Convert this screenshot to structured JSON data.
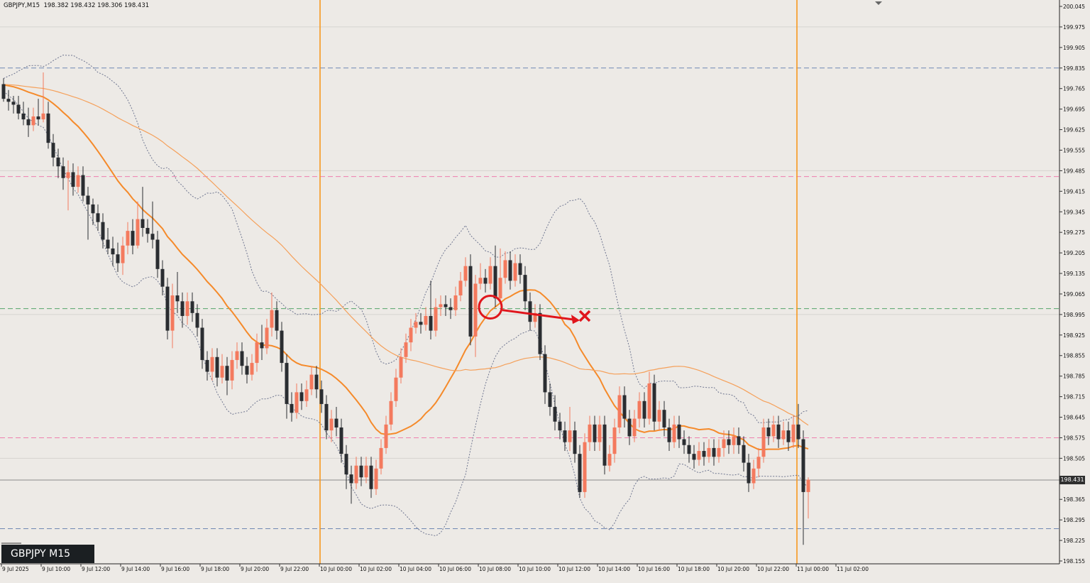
{
  "header": {
    "symbol": "GBPJPY,M15",
    "ohlc": "198.382 198.432 198.306 198.431"
  },
  "chart_tag": "GBPJPY M15",
  "current_price_label": "198.431",
  "colors": {
    "background": "#edeae6",
    "bull_candle": "#f47a5e",
    "bear_candle": "#2a2d31",
    "ma_fast": "#f58a2a",
    "ma_slow": "#f5a05a",
    "bollinger": "#6f7690",
    "session_line": "#f7971e",
    "annotation": "#e0151c"
  },
  "chart_data": {
    "type": "candlestick",
    "timeframe": "M15",
    "ylim": [
      198.155,
      200.045
    ],
    "y_ticks": [
      "200.045",
      "199.975",
      "199.905",
      "199.835",
      "199.765",
      "199.695",
      "199.625",
      "199.555",
      "199.485",
      "199.415",
      "199.345",
      "199.275",
      "199.205",
      "199.135",
      "199.065",
      "198.995",
      "198.925",
      "198.855",
      "198.785",
      "198.715",
      "198.645",
      "198.575",
      "198.505",
      "198.435",
      "198.365",
      "198.295",
      "198.225",
      "198.155"
    ],
    "x_ticks": [
      "9 Jul 2025",
      "9 Jul 10:00",
      "9 Jul 12:00",
      "9 Jul 14:00",
      "9 Jul 16:00",
      "9 Jul 18:00",
      "9 Jul 20:00",
      "9 Jul 22:00",
      "10 Jul 00:00",
      "10 Jul 02:00",
      "10 Jul 04:00",
      "10 Jul 06:00",
      "10 Jul 08:00",
      "10 Jul 10:00",
      "10 Jul 12:00",
      "10 Jul 14:00",
      "10 Jul 16:00",
      "10 Jul 18:00",
      "10 Jul 20:00",
      "10 Jul 22:00",
      "11 Jul 00:00",
      "11 Jul 02:00"
    ],
    "current_price": 198.431,
    "horizontal_levels": [
      {
        "price": 199.835,
        "style": "blue-dashed"
      },
      {
        "price": 199.465,
        "style": "pink-dashed"
      },
      {
        "price": 199.015,
        "style": "green-dashed"
      },
      {
        "price": 198.575,
        "style": "pink-dashed"
      },
      {
        "price": 198.265,
        "style": "blue-dashed"
      }
    ],
    "session_lines": [
      "10 Jul 00:00",
      "11 Jul 00:00"
    ],
    "series": [
      {
        "indicator": "moving-average-fast"
      },
      {
        "indicator": "moving-average-slow"
      },
      {
        "indicator": "bollinger-bands"
      }
    ],
    "annotations": [
      {
        "type": "circle",
        "price": 199.02
      },
      {
        "type": "arrow",
        "from_price": 199.01,
        "to_price": 198.975
      },
      {
        "type": "cross",
        "price": 198.99
      }
    ],
    "candles": [
      [
        199.78,
        199.73,
        199.8,
        199.72
      ],
      [
        199.73,
        199.72,
        199.76,
        199.69
      ],
      [
        199.72,
        199.71,
        199.74,
        199.68
      ],
      [
        199.71,
        199.68,
        199.74,
        199.66
      ],
      [
        199.68,
        199.66,
        199.72,
        199.64
      ],
      [
        199.66,
        199.64,
        199.7,
        199.6
      ],
      [
        199.64,
        199.67,
        199.7,
        199.62
      ],
      [
        199.67,
        199.66,
        199.73,
        199.64
      ],
      [
        199.66,
        199.68,
        199.82,
        199.65
      ],
      [
        199.68,
        199.58,
        199.72,
        199.56
      ],
      [
        199.58,
        199.53,
        199.61,
        199.5
      ],
      [
        199.53,
        199.5,
        199.56,
        199.46
      ],
      [
        199.5,
        199.46,
        199.53,
        199.42
      ],
      [
        199.46,
        199.48,
        199.52,
        199.35
      ],
      [
        199.48,
        199.43,
        199.51,
        199.4
      ],
      [
        199.43,
        199.47,
        199.5,
        199.41
      ],
      [
        199.47,
        199.4,
        199.5,
        199.38
      ],
      [
        199.4,
        199.37,
        199.43,
        199.25
      ],
      [
        199.37,
        199.34,
        199.39,
        199.3
      ],
      [
        199.34,
        199.31,
        199.37,
        199.28
      ],
      [
        199.31,
        199.25,
        199.34,
        199.22
      ],
      [
        199.25,
        199.22,
        199.29,
        199.2
      ],
      [
        199.22,
        199.2,
        199.26,
        199.16
      ],
      [
        199.2,
        199.17,
        199.24,
        199.14
      ],
      [
        199.17,
        199.23,
        199.26,
        199.13
      ],
      [
        199.23,
        199.28,
        199.31,
        199.2
      ],
      [
        199.28,
        199.23,
        199.32,
        199.2
      ],
      [
        199.23,
        199.32,
        199.38,
        199.22
      ],
      [
        199.32,
        199.29,
        199.43,
        199.26
      ],
      [
        199.29,
        199.27,
        199.32,
        199.24
      ],
      [
        199.27,
        199.25,
        199.38,
        199.22
      ],
      [
        199.25,
        199.15,
        199.28,
        199.12
      ],
      [
        199.15,
        199.09,
        199.18,
        199.06
      ],
      [
        199.09,
        198.94,
        199.12,
        198.91
      ],
      [
        198.94,
        199.06,
        199.1,
        198.88
      ],
      [
        199.06,
        199.04,
        199.14,
        199.0
      ],
      [
        199.04,
        198.99,
        199.07,
        198.95
      ],
      [
        198.99,
        199.04,
        199.07,
        198.96
      ],
      [
        199.04,
        199.0,
        199.07,
        198.97
      ],
      [
        199.0,
        198.95,
        199.03,
        198.92
      ],
      [
        198.95,
        198.84,
        198.98,
        198.81
      ],
      [
        198.84,
        198.8,
        198.87,
        198.77
      ],
      [
        198.8,
        198.85,
        198.88,
        198.77
      ],
      [
        198.85,
        198.78,
        198.88,
        198.75
      ],
      [
        198.78,
        198.82,
        198.86,
        198.76
      ],
      [
        198.82,
        198.77,
        198.85,
        198.72
      ],
      [
        198.77,
        198.84,
        198.87,
        198.74
      ],
      [
        198.84,
        198.87,
        198.9,
        198.81
      ],
      [
        198.87,
        198.82,
        198.9,
        198.79
      ],
      [
        198.82,
        198.79,
        198.85,
        198.76
      ],
      [
        198.79,
        198.83,
        198.86,
        198.77
      ],
      [
        198.83,
        198.9,
        198.93,
        198.8
      ],
      [
        198.9,
        198.88,
        198.96,
        198.84
      ],
      [
        198.88,
        198.95,
        198.98,
        198.86
      ],
      [
        198.95,
        199.01,
        199.07,
        198.92
      ],
      [
        199.01,
        198.94,
        199.04,
        198.91
      ],
      [
        198.94,
        198.83,
        198.97,
        198.8
      ],
      [
        198.83,
        198.69,
        198.86,
        198.64
      ],
      [
        198.69,
        198.66,
        198.73,
        198.63
      ],
      [
        198.66,
        198.73,
        198.76,
        198.64
      ],
      [
        198.73,
        198.7,
        198.76,
        198.67
      ],
      [
        198.7,
        198.74,
        198.77,
        198.68
      ],
      [
        198.74,
        198.79,
        198.82,
        198.72
      ],
      [
        198.79,
        198.74,
        198.82,
        198.71
      ],
      [
        198.74,
        198.69,
        198.77,
        198.66
      ],
      [
        198.69,
        198.6,
        198.72,
        198.57
      ],
      [
        198.6,
        198.64,
        198.67,
        198.56
      ],
      [
        198.64,
        198.61,
        198.68,
        198.58
      ],
      [
        198.61,
        198.52,
        198.64,
        198.49
      ],
      [
        198.52,
        198.45,
        198.55,
        198.4
      ],
      [
        198.45,
        198.42,
        198.48,
        198.35
      ],
      [
        198.42,
        198.48,
        198.51,
        198.4
      ],
      [
        198.48,
        198.44,
        198.51,
        198.41
      ],
      [
        198.44,
        198.48,
        198.51,
        198.42
      ],
      [
        198.48,
        198.4,
        198.51,
        198.37
      ],
      [
        198.4,
        198.47,
        198.5,
        198.38
      ],
      [
        198.47,
        198.54,
        198.57,
        198.45
      ],
      [
        198.54,
        198.62,
        198.65,
        198.52
      ],
      [
        198.62,
        198.7,
        198.73,
        198.6
      ],
      [
        198.7,
        198.78,
        198.81,
        198.68
      ],
      [
        198.78,
        198.85,
        198.88,
        198.76
      ],
      [
        198.85,
        198.9,
        198.93,
        198.83
      ],
      [
        198.9,
        198.95,
        198.98,
        198.87
      ],
      [
        198.95,
        198.97,
        199.0,
        198.93
      ],
      [
        198.97,
        198.96,
        199.0,
        198.93
      ],
      [
        198.96,
        198.99,
        199.02,
        198.94
      ],
      [
        198.99,
        198.94,
        199.11,
        198.91
      ],
      [
        198.94,
        199.02,
        199.05,
        198.92
      ],
      [
        199.02,
        199.03,
        199.06,
        198.99
      ],
      [
        199.03,
        199.02,
        199.06,
        198.99
      ],
      [
        199.02,
        199.01,
        199.05,
        198.98
      ],
      [
        199.01,
        199.06,
        199.09,
        198.99
      ],
      [
        199.06,
        199.11,
        199.14,
        199.04
      ],
      [
        199.11,
        199.16,
        199.19,
        199.09
      ],
      [
        199.16,
        198.92,
        199.2,
        198.89
      ],
      [
        198.92,
        199.1,
        199.13,
        198.85
      ],
      [
        199.1,
        199.12,
        199.17,
        199.08
      ],
      [
        199.12,
        199.1,
        199.15,
        199.07
      ],
      [
        199.1,
        199.16,
        199.19,
        199.08
      ],
      [
        199.16,
        199.05,
        199.23,
        199.02
      ],
      [
        199.05,
        199.12,
        199.22,
        199.03
      ],
      [
        199.12,
        199.18,
        199.21,
        199.1
      ],
      [
        199.18,
        199.11,
        199.21,
        199.08
      ],
      [
        199.11,
        199.17,
        199.2,
        199.09
      ],
      [
        199.17,
        199.13,
        199.2,
        199.1
      ],
      [
        199.13,
        199.04,
        199.16,
        199.01
      ],
      [
        199.04,
        198.97,
        199.07,
        198.94
      ],
      [
        198.97,
        199.0,
        199.03,
        198.95
      ],
      [
        199.0,
        198.86,
        199.03,
        198.84
      ],
      [
        198.86,
        198.73,
        198.89,
        198.69
      ],
      [
        198.73,
        198.68,
        198.76,
        198.65
      ],
      [
        198.68,
        198.63,
        198.72,
        198.6
      ],
      [
        198.63,
        198.6,
        198.66,
        198.57
      ],
      [
        198.6,
        198.56,
        198.63,
        198.53
      ],
      [
        198.56,
        198.6,
        198.68,
        198.53
      ],
      [
        198.6,
        198.52,
        198.63,
        198.49
      ],
      [
        198.52,
        198.39,
        198.55,
        198.37
      ],
      [
        198.39,
        198.56,
        198.59,
        198.37
      ],
      [
        198.56,
        198.62,
        198.65,
        198.53
      ],
      [
        198.62,
        198.56,
        198.65,
        198.53
      ],
      [
        198.56,
        198.62,
        198.65,
        198.53
      ],
      [
        198.62,
        198.48,
        198.65,
        198.45
      ],
      [
        198.48,
        198.52,
        198.55,
        198.46
      ],
      [
        198.52,
        198.61,
        198.64,
        198.49
      ],
      [
        198.61,
        198.72,
        198.75,
        198.59
      ],
      [
        198.72,
        198.64,
        198.75,
        198.61
      ],
      [
        198.64,
        198.58,
        198.67,
        198.55
      ],
      [
        198.58,
        198.64,
        198.67,
        198.56
      ],
      [
        198.64,
        198.7,
        198.73,
        198.61
      ],
      [
        198.7,
        198.64,
        198.73,
        198.61
      ],
      [
        198.64,
        198.76,
        198.8,
        198.62
      ],
      [
        198.76,
        198.63,
        198.79,
        198.6
      ],
      [
        198.63,
        198.67,
        198.7,
        198.6
      ],
      [
        198.67,
        198.61,
        198.7,
        198.58
      ],
      [
        198.61,
        198.56,
        198.64,
        198.53
      ],
      [
        198.56,
        198.62,
        198.65,
        198.54
      ],
      [
        198.62,
        198.57,
        198.65,
        198.54
      ],
      [
        198.57,
        198.55,
        198.6,
        198.52
      ],
      [
        198.55,
        198.52,
        198.58,
        198.49
      ],
      [
        198.52,
        198.5,
        198.55,
        198.47
      ],
      [
        198.5,
        198.53,
        198.56,
        198.48
      ],
      [
        198.53,
        198.51,
        198.56,
        198.48
      ],
      [
        198.51,
        198.54,
        198.57,
        198.49
      ],
      [
        198.54,
        198.51,
        198.57,
        198.48
      ],
      [
        198.51,
        198.54,
        198.57,
        198.49
      ],
      [
        198.54,
        198.57,
        198.6,
        198.51
      ],
      [
        198.57,
        198.55,
        198.6,
        198.52
      ],
      [
        198.55,
        198.58,
        198.61,
        198.52
      ],
      [
        198.58,
        198.55,
        198.61,
        198.52
      ],
      [
        198.55,
        198.49,
        198.58,
        198.46
      ],
      [
        198.49,
        198.42,
        198.52,
        198.39
      ],
      [
        198.42,
        198.47,
        198.5,
        198.4
      ],
      [
        198.47,
        198.51,
        198.54,
        198.44
      ],
      [
        198.51,
        198.61,
        198.64,
        198.49
      ],
      [
        198.61,
        198.58,
        198.64,
        198.55
      ],
      [
        198.58,
        198.62,
        198.65,
        198.56
      ],
      [
        198.62,
        198.57,
        198.65,
        198.54
      ],
      [
        198.57,
        198.6,
        198.63,
        198.55
      ],
      [
        198.6,
        198.56,
        198.63,
        198.53
      ],
      [
        198.56,
        198.62,
        198.65,
        198.54
      ],
      [
        198.62,
        198.57,
        198.69,
        198.54
      ],
      [
        198.57,
        198.39,
        198.6,
        198.21
      ],
      [
        198.39,
        198.432,
        198.44,
        198.3
      ]
    ]
  }
}
